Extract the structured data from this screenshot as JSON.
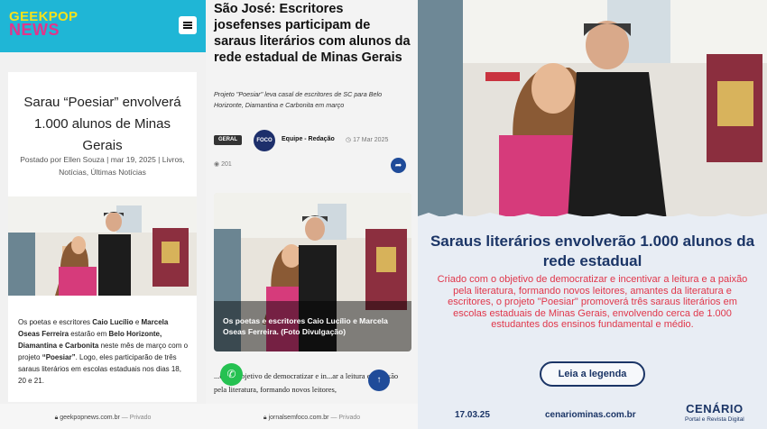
{
  "panel1": {
    "logo_line1": "GEEKPOP",
    "logo_line2": "NEWS",
    "title": "Sarau “Poesiar” envolverá 1.000 alunos de Minas Gerais",
    "meta_prefix": "Postado por",
    "author": "Ellen Souza",
    "date": "mar 19, 2025",
    "categories": "Livros, Notícias, Últimas Notícias",
    "body": [
      {
        "t": "Os poetas e escritores ",
        "b": false
      },
      {
        "t": "Caio Lucílio",
        "b": true
      },
      {
        "t": " e ",
        "b": false
      },
      {
        "t": "Marcela Oseas Ferreira",
        "b": true
      },
      {
        "t": " estarão em ",
        "b": false
      },
      {
        "t": "Belo Horizonte, Diamantina e Carbonita",
        "b": true
      },
      {
        "t": " neste mês de março com o projeto ",
        "b": false
      },
      {
        "t": "“Poesiar”",
        "b": true
      },
      {
        "t": ". Logo, eles participarão de três saraus literários em escolas estaduais nos dias 18, 20 e 21.",
        "b": false
      }
    ],
    "url": "geekpopnews.com.br",
    "url_private": "— Privado"
  },
  "panel2": {
    "title": "São José: Escritores josefenses participam de saraus literários com alunos da rede estadual de Minas Gerais",
    "subtitle": "Projeto \"Poesiar\" leva casal de escritores de SC para Belo Horizonte, Diamantina e Carbonita em março",
    "tag": "GERAL",
    "author_logo": "FOCO",
    "author": "Equipe - Redação",
    "date": "17 Mar 2025",
    "views": "201",
    "caption": "Os poetas e escritores Caio Lucílio e Marcela Oseas Ferreira. (Foto Divulgação)",
    "body": "...om o objetivo de democratizar e in...ar a leitura e a paixão pela literatura, formando novos leitores,",
    "url": "jornalsemfoco.com.br",
    "url_private": "— Privado"
  },
  "panel3": {
    "headline": "Saraus literários envolverão 1.000 alunos da rede estadual",
    "text": "Criado com o objetivo de democratizar e incentivar a leitura e a paixão pela literatura, formando novos leitores, amantes da literatura e escritores, o projeto \"Poesiar\" promoverá três saraus literários em escolas estaduais de Minas Gerais, envolvendo cerca de 1.000 estudantes dos ensinos fundamental e médio.",
    "button": "Leia a legenda",
    "date": "17.03.25",
    "site": "cenariominas.com.br",
    "brand": "CENÁRIO",
    "brand_sub": "Portal e Revista Digital"
  },
  "colors": {
    "geekpop_header": "#1fb6d6",
    "cenario_navy": "#1b3566",
    "cenario_red": "#e0364a",
    "foco_blue": "#1f4b99"
  }
}
